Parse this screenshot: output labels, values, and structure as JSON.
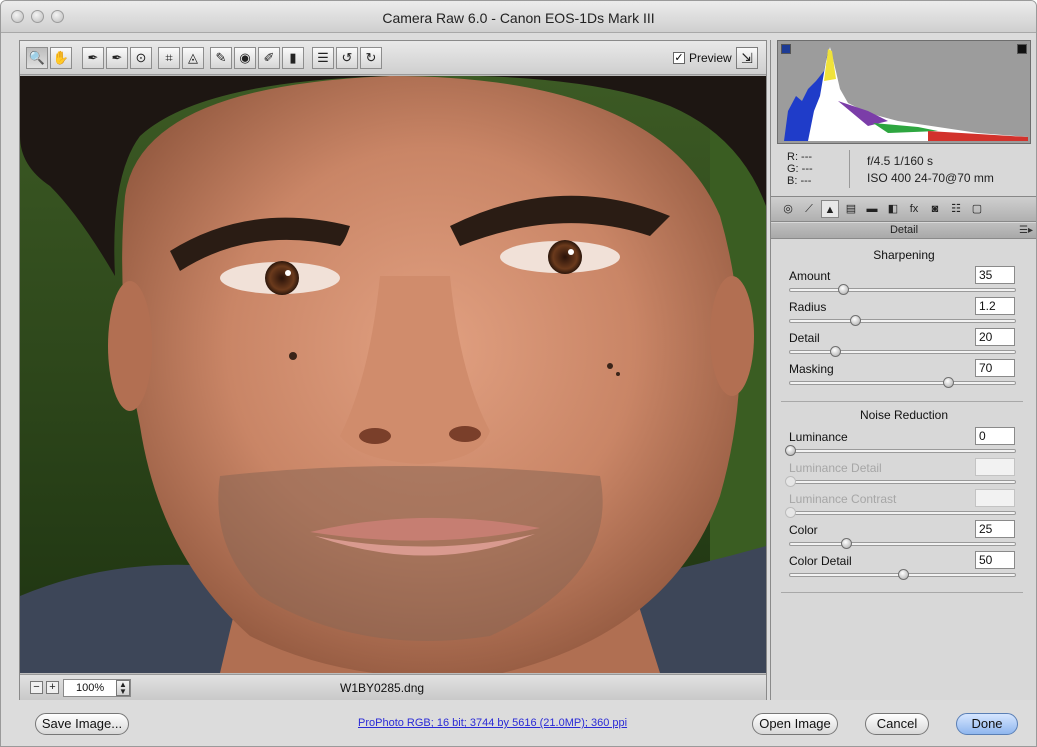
{
  "window": {
    "title": "Camera Raw 6.0  -  Canon EOS-1Ds Mark III"
  },
  "toolbar": {
    "tools": [
      {
        "name": "zoom-tool-icon",
        "glyph": "🔍",
        "active": true
      },
      {
        "name": "hand-tool-icon",
        "glyph": "✋"
      },
      {
        "name": "white-balance-tool-icon",
        "glyph": "✒"
      },
      {
        "name": "color-sampler-tool-icon",
        "glyph": "✒"
      },
      {
        "name": "targeted-adjustment-tool-icon",
        "glyph": "⊙"
      },
      {
        "name": "crop-tool-icon",
        "glyph": "⌗"
      },
      {
        "name": "straighten-tool-icon",
        "glyph": "◬"
      },
      {
        "name": "spot-removal-tool-icon",
        "glyph": "✎"
      },
      {
        "name": "red-eye-tool-icon",
        "glyph": "◉"
      },
      {
        "name": "adjustment-brush-icon",
        "glyph": "✐"
      },
      {
        "name": "graduated-filter-icon",
        "glyph": "▮"
      },
      {
        "name": "preferences-icon",
        "glyph": "☰"
      },
      {
        "name": "rotate-ccw-icon",
        "glyph": "↺"
      },
      {
        "name": "rotate-cw-icon",
        "glyph": "↻"
      }
    ],
    "preview_label": "Preview",
    "preview_checked": true
  },
  "image": {
    "filename": "W1BY0285.dng"
  },
  "zoom": {
    "value": "100%"
  },
  "readout": {
    "r": "R:  ---",
    "g": "G:  ---",
    "b": "B:  ---",
    "aperture_shutter": "f/4.5   1/160 s",
    "iso_lens": "ISO 400   24-70@70 mm"
  },
  "panel_tabs": [
    "basic",
    "tone-curve",
    "detail",
    "hsl",
    "split-toning",
    "lens",
    "fx",
    "camera-calibration",
    "presets",
    "snapshots"
  ],
  "panel": {
    "title": "Detail",
    "sharpening_title": "Sharpening",
    "noise_title": "Noise Reduction",
    "sliders": [
      {
        "label": "Amount",
        "value": "35",
        "fraction": 0.235,
        "enabled": true
      },
      {
        "label": "Radius",
        "value": "1.2",
        "fraction": 0.29,
        "enabled": true
      },
      {
        "label": "Detail",
        "value": "20",
        "fraction": 0.2,
        "enabled": true
      },
      {
        "label": "Masking",
        "value": "70",
        "fraction": 0.7,
        "enabled": true
      },
      {
        "label": "Luminance",
        "value": "0",
        "fraction": 0.0,
        "enabled": true
      },
      {
        "label": "Luminance Detail",
        "value": "",
        "fraction": 0.0,
        "enabled": false
      },
      {
        "label": "Luminance Contrast",
        "value": "",
        "fraction": 0.0,
        "enabled": false
      },
      {
        "label": "Color",
        "value": "25",
        "fraction": 0.25,
        "enabled": true
      },
      {
        "label": "Color Detail",
        "value": "50",
        "fraction": 0.5,
        "enabled": true
      }
    ]
  },
  "footer": {
    "save_label": "Save Image...",
    "workflow_label": "ProPhoto RGB; 16 bit; 3744 by 5616 (21.0MP); 360 ppi",
    "open_label": "Open Image",
    "cancel_label": "Cancel",
    "done_label": "Done"
  },
  "colors": {
    "accent": "#8fb6ee",
    "link": "#2a2ad6"
  }
}
